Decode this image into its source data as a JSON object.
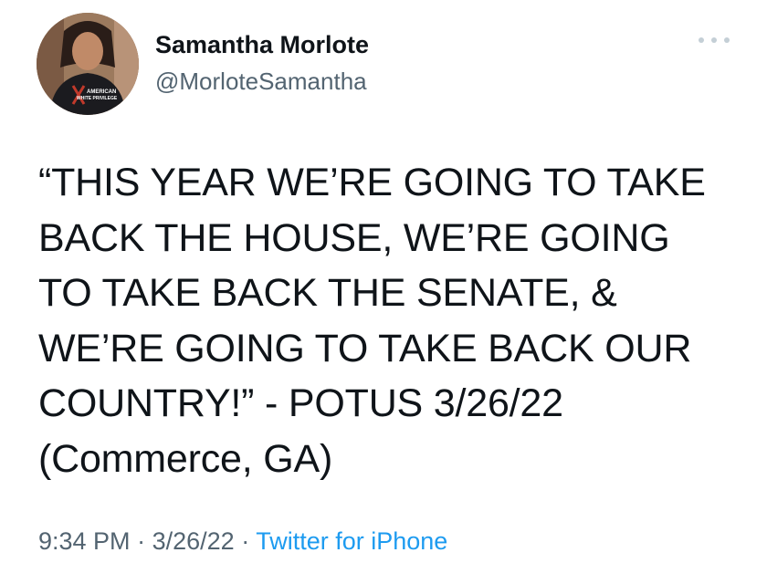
{
  "author": {
    "display_name": "Samantha Morlote",
    "handle": "@MorloteSamantha",
    "avatar_shirt_text_1": "AMERICAN",
    "avatar_shirt_text_2": "WHITE PRIVILEGE"
  },
  "menu": {
    "icon": "more-horizontal-icon"
  },
  "tweet": {
    "text_lines": [
      "“THIS YEAR WE’RE GOING TO TAKE",
      "BACK THE HOUSE, WE’RE GOING",
      "TO TAKE BACK THE SENATE, &",
      "WE’RE GOING TO TAKE BACK OUR",
      "COUNTRY!” - POTUS 3/26/22",
      "(Commerce, GA)"
    ],
    "time": "9:34 PM",
    "separator": "·",
    "date": "3/26/22",
    "source": "Twitter for iPhone"
  },
  "colors": {
    "text": "#0f1419",
    "secondary": "#536471",
    "link": "#1d9bf0"
  }
}
